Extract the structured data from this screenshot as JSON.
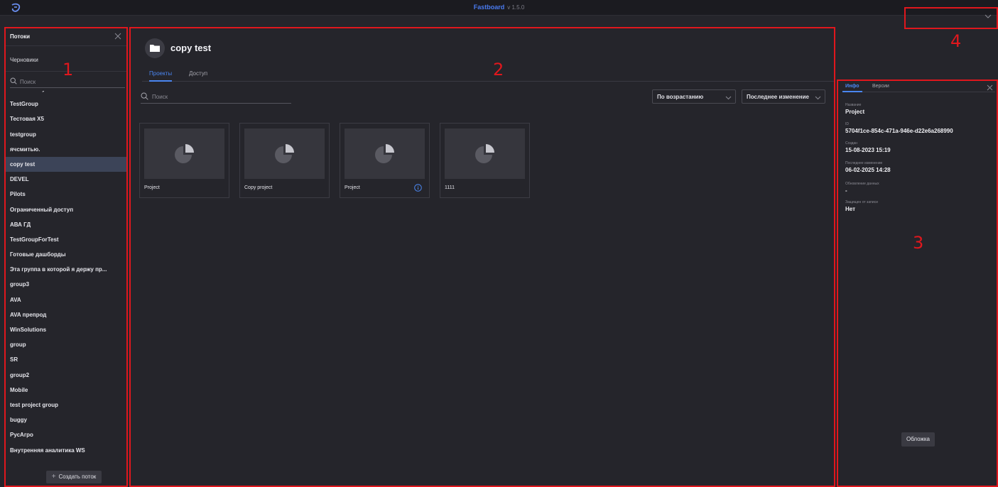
{
  "header": {
    "brand": "Fastboard",
    "version": "v 1.5.0"
  },
  "sidebar": {
    "title": "Потоки",
    "drafts": "Черновики",
    "search_placeholder": "Поиск",
    "items": [
      "TestFilialsalyariv",
      "TestGroup",
      "Тестовая X5",
      "testgroup",
      "ячсмитью.",
      "copy test",
      "DEVEL",
      "Pilots",
      "Ограниченный доступ",
      "АВА ГД",
      "TestGroupForTest",
      "Готовые дашборды",
      "Эта группа в которой я держу пр...",
      "group3",
      "AVA",
      "AVA препрод",
      "WinSolutions",
      "group",
      "SR",
      "group2",
      "Mobile",
      "test project group",
      "buggy",
      "РусАгро",
      "Внутренняя аналитика WS"
    ],
    "active_index": 5,
    "create_label": "Создать поток"
  },
  "main": {
    "title": "copy test",
    "tabs": [
      "Проекты",
      "Доступ"
    ],
    "search_placeholder": "Поиск",
    "sort_order": "По возрастанию",
    "sort_field": "Последнее изменение",
    "projects": [
      "Project",
      "Copy project",
      "Project",
      "1111"
    ]
  },
  "info_panel": {
    "tabs": [
      "Инфо",
      "Версии"
    ],
    "fields": [
      {
        "label": "Название",
        "value": "Project"
      },
      {
        "label": "ID",
        "value": "5704f1ce-854c-471a-946e-d22e6a268990"
      },
      {
        "label": "Создан",
        "value": "15-08-2023 15:19"
      },
      {
        "label": "Последнее изменение",
        "value": "06-02-2025 14:28"
      },
      {
        "label": "Обновление данных",
        "value": "-"
      },
      {
        "label": "Защищен от записи",
        "value": "Нет"
      }
    ],
    "cover_button": "Обложка"
  },
  "annotations": [
    "1",
    "2",
    "3",
    "4"
  ],
  "colors": {
    "accent": "#4a86f0",
    "annotation": "#e0171d",
    "background": "#25252b"
  }
}
